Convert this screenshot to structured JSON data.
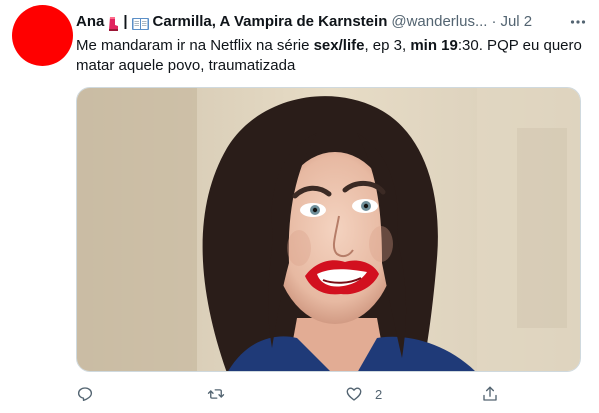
{
  "tweet": {
    "author_name": "Ana",
    "pipe": "|",
    "display_title": "Carmilla, A Vampira de Karnstein",
    "handle": "@wanderlus...",
    "dot": "·",
    "date": "Jul 2",
    "text_parts": {
      "p1": "Me mandaram ir na Netflix na série ",
      "b1": "sex/life",
      "p2": ", ep 3, ",
      "b2": "min 19",
      "p3": ":30. PQP eu quero matar aquele povo, traumatizada"
    },
    "avatar_color": "#ff0000",
    "media": {
      "description_icon": "photo-of-woman-grimacing"
    },
    "actions": {
      "reply_count": "",
      "retweet_count": "",
      "like_count": "2",
      "share_count": ""
    }
  },
  "icons": {
    "more": "more-dots-icon",
    "reply": "reply-icon",
    "retweet": "retweet-icon",
    "like": "heart-icon",
    "share": "share-icon",
    "boot": "red-boot-emoji",
    "book": "open-book-emoji"
  },
  "colors": {
    "text": "#0f1419",
    "secondary": "#536471",
    "border": "#cfd9de"
  }
}
